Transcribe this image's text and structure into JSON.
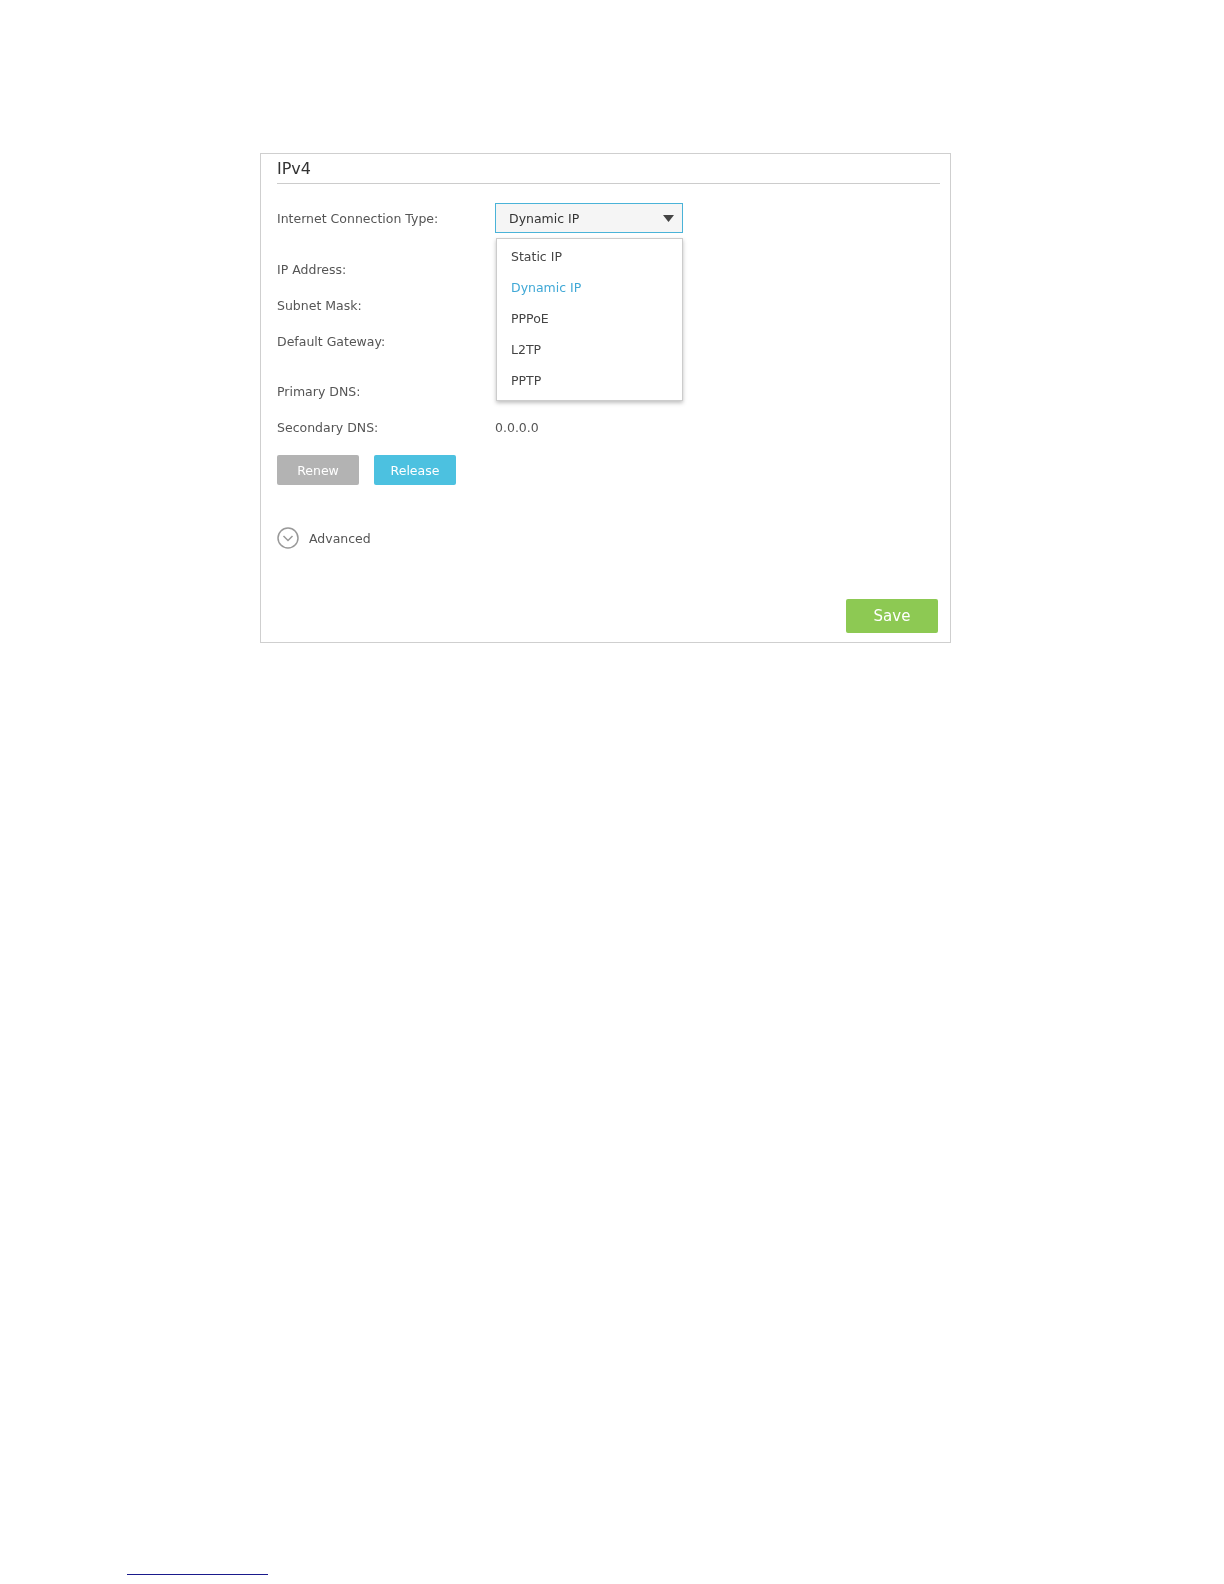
{
  "panel": {
    "title": "IPv4"
  },
  "connection_type": {
    "label": "Internet Connection Type:",
    "value": "Dynamic IP",
    "expanded": true,
    "options": [
      {
        "label": "Static IP",
        "selected": false
      },
      {
        "label": "Dynamic IP",
        "selected": true
      },
      {
        "label": "PPPoE",
        "selected": false
      },
      {
        "label": "L2TP",
        "selected": false
      },
      {
        "label": "PPTP",
        "selected": false
      }
    ]
  },
  "fields": [
    {
      "label": "IP Address:"
    },
    {
      "label": "Subnet Mask:"
    },
    {
      "label": "Default Gateway:"
    },
    {
      "label": "Primary DNS:"
    },
    {
      "label": "Secondary DNS:",
      "value": "0.0.0.0"
    }
  ],
  "buttons": [
    {
      "label": "Renew",
      "kind": "secondary"
    },
    {
      "label": "Release",
      "kind": "primary"
    }
  ],
  "advanced": {
    "label": "Advanced",
    "expanded": false
  },
  "save_button": "Save"
}
